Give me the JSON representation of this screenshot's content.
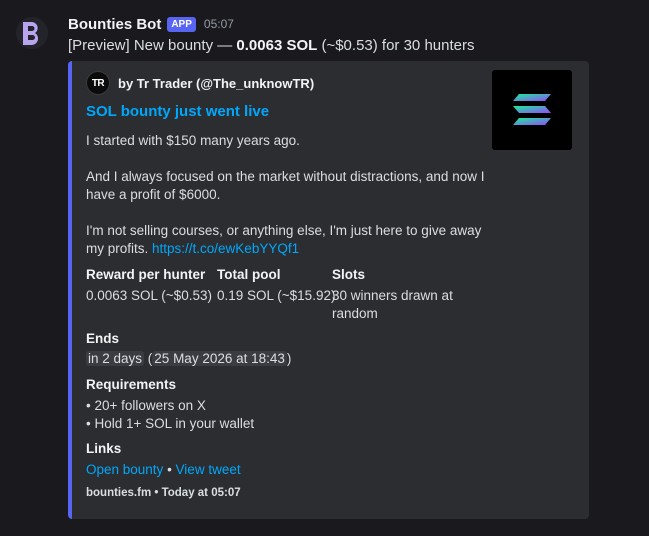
{
  "message": {
    "bot_name": "Bounties Bot",
    "badge": "APP",
    "time": "05:07",
    "preview_prefix": "[Preview] New bounty — ",
    "preview_amount": "0.0063 SOL",
    "preview_suffix": " (~$0.53) for 30 hunters"
  },
  "embed": {
    "accent_color": "#5865f2",
    "author_initials": "TR",
    "author": "by Tr Trader (@The_unknowTR)",
    "title": "SOL bounty just went live",
    "para1": "I started with $150 many years ago.",
    "para2": "And I always focused on the market without distractions, and now I have a profit of $6000.",
    "para3": "I'm not selling courses, or anything else, I'm just here to give away my profits. ",
    "para3_link": "https://t.co/ewKebYYQf1",
    "fields": {
      "reward_name": "Reward per hunter",
      "reward_value": "0.0063 SOL (~$0.53)",
      "pool_name": "Total pool",
      "pool_value": "0.19 SOL (~$15.92)",
      "slots_name": "Slots",
      "slots_value": "30 winners drawn at random",
      "ends_name": "Ends",
      "ends_relative": "in 2 days",
      "ends_absolute": "25 May 2026 at 18:43",
      "req_name": "Requirements",
      "req_1": "• 20+ followers on X",
      "req_2": "• Hold 1+ SOL in your wallet",
      "links_name": "Links",
      "link_open": "Open bounty",
      "link_sep": " • ",
      "link_tweet": "View tweet"
    },
    "footer": "bounties.fm • Today at 05:07"
  }
}
